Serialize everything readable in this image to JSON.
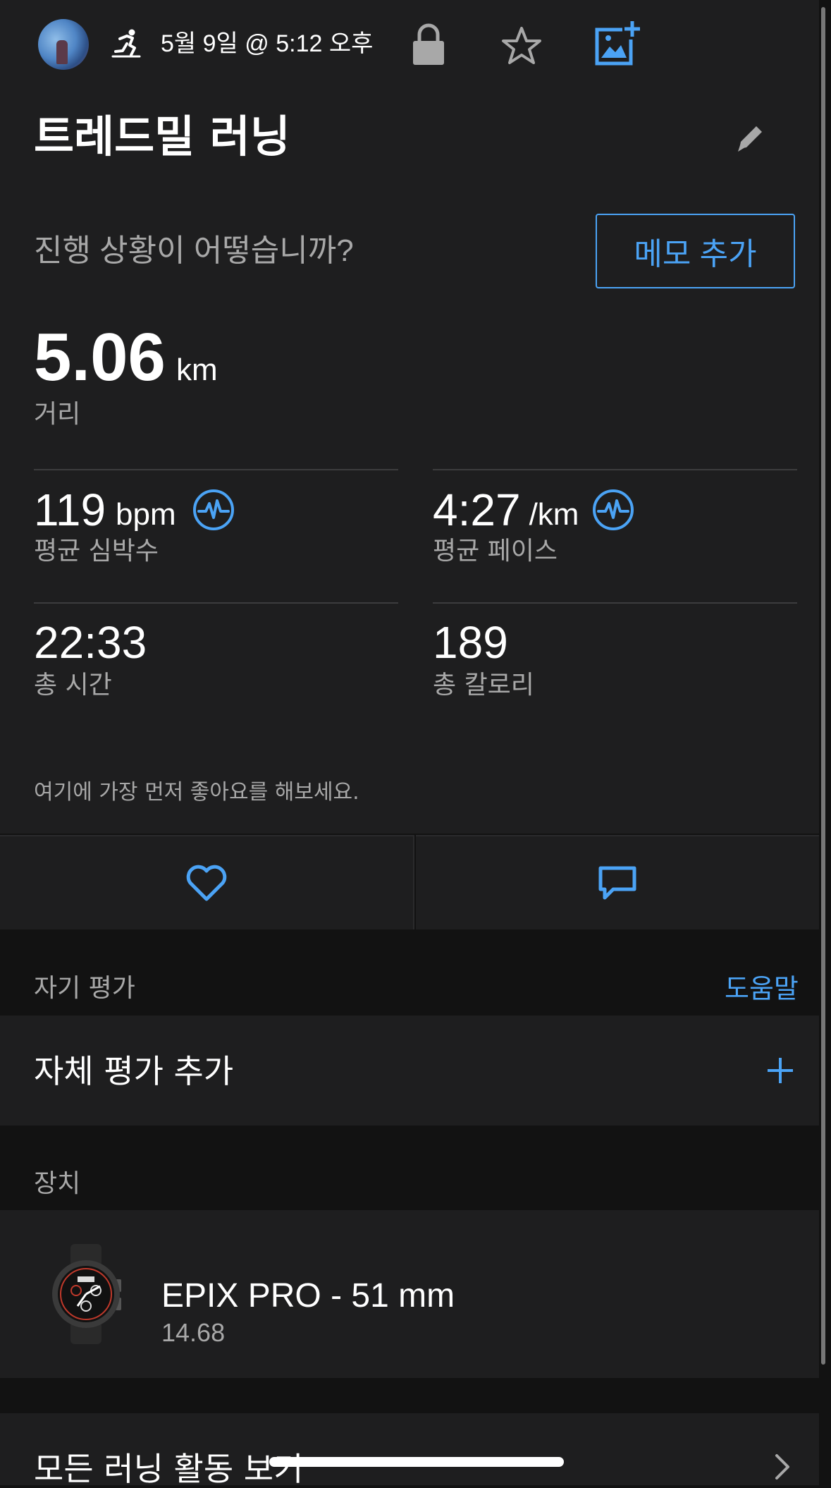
{
  "header": {
    "date_time": "5월 9일 @ 5:12 오후",
    "icons": [
      "avatar",
      "treadmill-run-icon",
      "lock-icon",
      "star-icon",
      "add-photo-icon"
    ]
  },
  "activity": {
    "title": "트레드밀 러닝",
    "prompt": "진행 상황이 어떻습니까?",
    "memo_button": "메모 추가"
  },
  "stats": {
    "distance": {
      "value": "5.06",
      "unit": "km",
      "label": "거리"
    },
    "heart_rate": {
      "value": "119",
      "unit": "bpm",
      "label": "평균 심박수"
    },
    "pace": {
      "value": "4:27",
      "unit": "/km",
      "label": "평균 페이스"
    },
    "time": {
      "value": "22:33",
      "label": "총 시간"
    },
    "calories": {
      "value": "189",
      "label": "총 칼로리"
    }
  },
  "social": {
    "like_prompt": "여기에 가장 먼저 좋아요를 해보세요."
  },
  "self_eval": {
    "section_label": "자기 평가",
    "help_link": "도움말",
    "add_label": "자체 평가 추가"
  },
  "device": {
    "section_label": "장치",
    "name": "EPIX PRO - 51 mm",
    "version": "14.68"
  },
  "footer": {
    "all_runs": "모든 러닝 활동 보기"
  },
  "colors": {
    "accent": "#4ba3f5",
    "background": "#121212",
    "card": "#1e1e1f"
  }
}
